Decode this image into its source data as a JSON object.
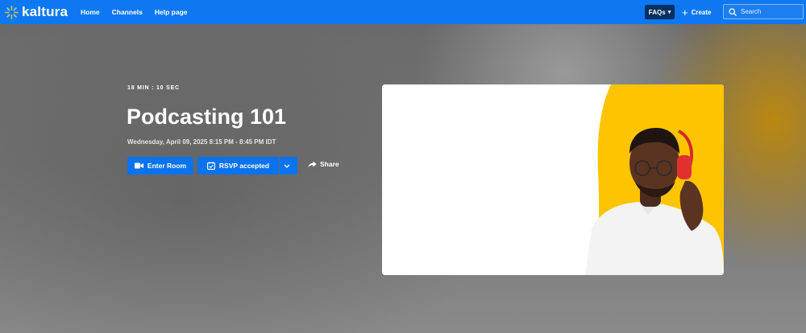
{
  "header": {
    "logo_text": "kaltura",
    "nav": [
      "Home",
      "Channels",
      "Help page"
    ],
    "faq_label": "FAQs",
    "create_label": "Create",
    "search_placeholder": "Search"
  },
  "event": {
    "duration": "18 MIN  :  10 SEC",
    "title": "Podcasting 101",
    "datetime": "Wednesday, April 09, 2025  8:15 PM - 8:45 PM IDT",
    "enter_label": "Enter Room",
    "rsvp_label": "RSVP accepted",
    "share_label": "Share"
  },
  "colors": {
    "brand_blue": "#0d78f2",
    "faq_bg": "#072f5f",
    "button_blue": "#0b73ee",
    "thumbnail_accent": "#ffc400"
  }
}
